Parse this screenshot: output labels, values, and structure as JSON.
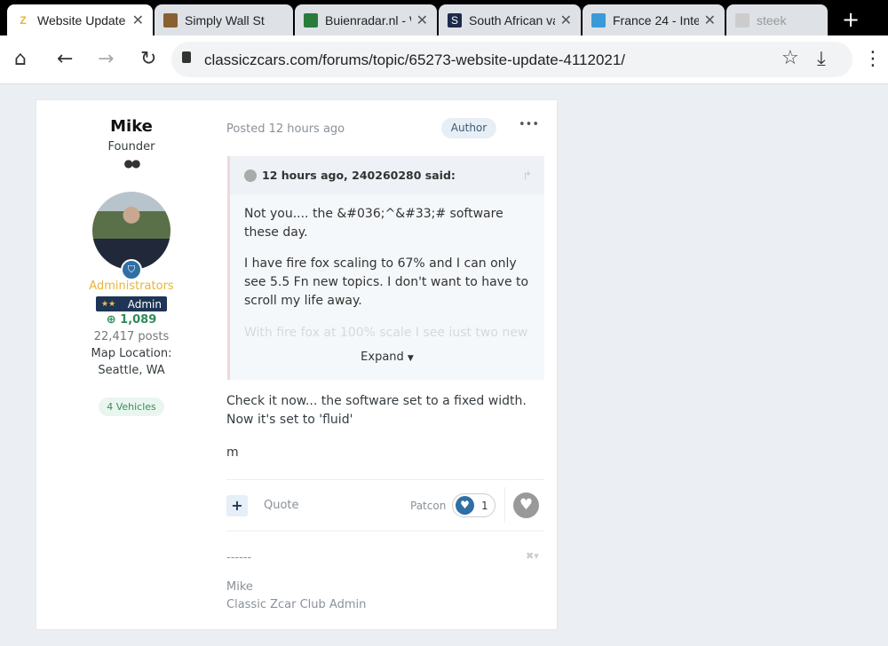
{
  "browser": {
    "tabs": [
      {
        "title": "Website Update",
        "favicon": "zcar-icon",
        "color": "#f0b030",
        "active": true
      },
      {
        "title": "Simply Wall St",
        "favicon": "owl-icon",
        "color": "#8a6030"
      },
      {
        "title": "Buienradar.nl - W",
        "favicon": "radar-icon",
        "color": "#2a7a3a"
      },
      {
        "title": "South African va",
        "favicon": "s-icon",
        "color": "#1c2a4a"
      },
      {
        "title": "France 24 - Inter",
        "favicon": "france24-icon",
        "color": "#3a9ad8"
      },
      {
        "title": "steek",
        "favicon": "steek-icon",
        "color": "#ccc"
      }
    ],
    "url": "classiczcars.com/forums/topic/65273-website-update-4112021/"
  },
  "author": {
    "name": "Mike",
    "title": "Founder",
    "group": "Administrators",
    "badge": "Admin",
    "reputation": "1,089",
    "posts": "22,417 posts",
    "location_label": "Map Location:",
    "location": "Seattle, WA",
    "vehicles": "4 Vehicles",
    "group_color": "#e8b43a"
  },
  "post": {
    "posted": "Posted 12 hours ago",
    "author_badge": "Author",
    "menu": "•••",
    "quote": {
      "header": "12 hours ago, 240260280 said:",
      "paragraphs": [
        "Not you.... the &#036;^&#33;# software these day.",
        "I have fire fox scaling to 67% and I can only see 5.5 Fn new topics.  I don't want to have to scroll my life away."
      ],
      "faded": "With fire fox at 100% scale I see just two new",
      "expand": "Expand"
    },
    "body": [
      "Check it now...  the software set to a fixed width.  Now it's set to 'fluid'",
      "m"
    ],
    "quote_button": "Quote",
    "reaction_user": "Patcon",
    "reaction_count": "1",
    "signature": {
      "dashes": "------",
      "line1": "Mike",
      "line2": "Classic Zcar Club Admin"
    }
  }
}
